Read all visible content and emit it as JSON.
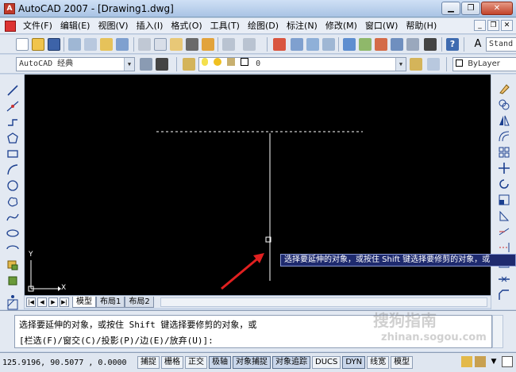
{
  "window": {
    "title": "AutoCAD 2007 - [Drawing1.dwg]",
    "app_icon_letter": "A"
  },
  "menu": {
    "items": [
      "文件(F)",
      "编辑(E)",
      "视图(V)",
      "插入(I)",
      "格式(O)",
      "工具(T)",
      "绘图(D)",
      "标注(N)",
      "修改(M)",
      "窗口(W)",
      "帮助(H)"
    ]
  },
  "toolbar": {
    "workspace": "AutoCAD 经典",
    "layer": "0",
    "text_style": "Stand",
    "color": "ByLayer"
  },
  "layout_tabs": [
    "模型",
    "布局1",
    "布局2"
  ],
  "drawing": {
    "ucs_x": "X",
    "ucs_y": "Y",
    "tooltip": "选择要延伸的对象，或按住 Shift 键选择要修剪的对象，或"
  },
  "command": {
    "line1": "选择要延伸的对象，或按住 Shift 键选择要修剪的对象，或",
    "line2": "[栏选(F)/窗交(C)/投影(P)/边(E)/放弃(U)]:"
  },
  "status": {
    "coords": "125.9196,  90.5077 , 0.0000",
    "buttons": [
      "捕捉",
      "栅格",
      "正交",
      "极轴",
      "对象捕捉",
      "对象追踪",
      "DUCS",
      "DYN",
      "线宽",
      "模型"
    ]
  },
  "watermark": {
    "line1": "搜狗指南",
    "line2": "zhinan.sogou.com"
  },
  "colors": {
    "canvas_bg": "#000000",
    "tooltip_bg": "#1e2a6e",
    "arrow": "#e02020"
  }
}
